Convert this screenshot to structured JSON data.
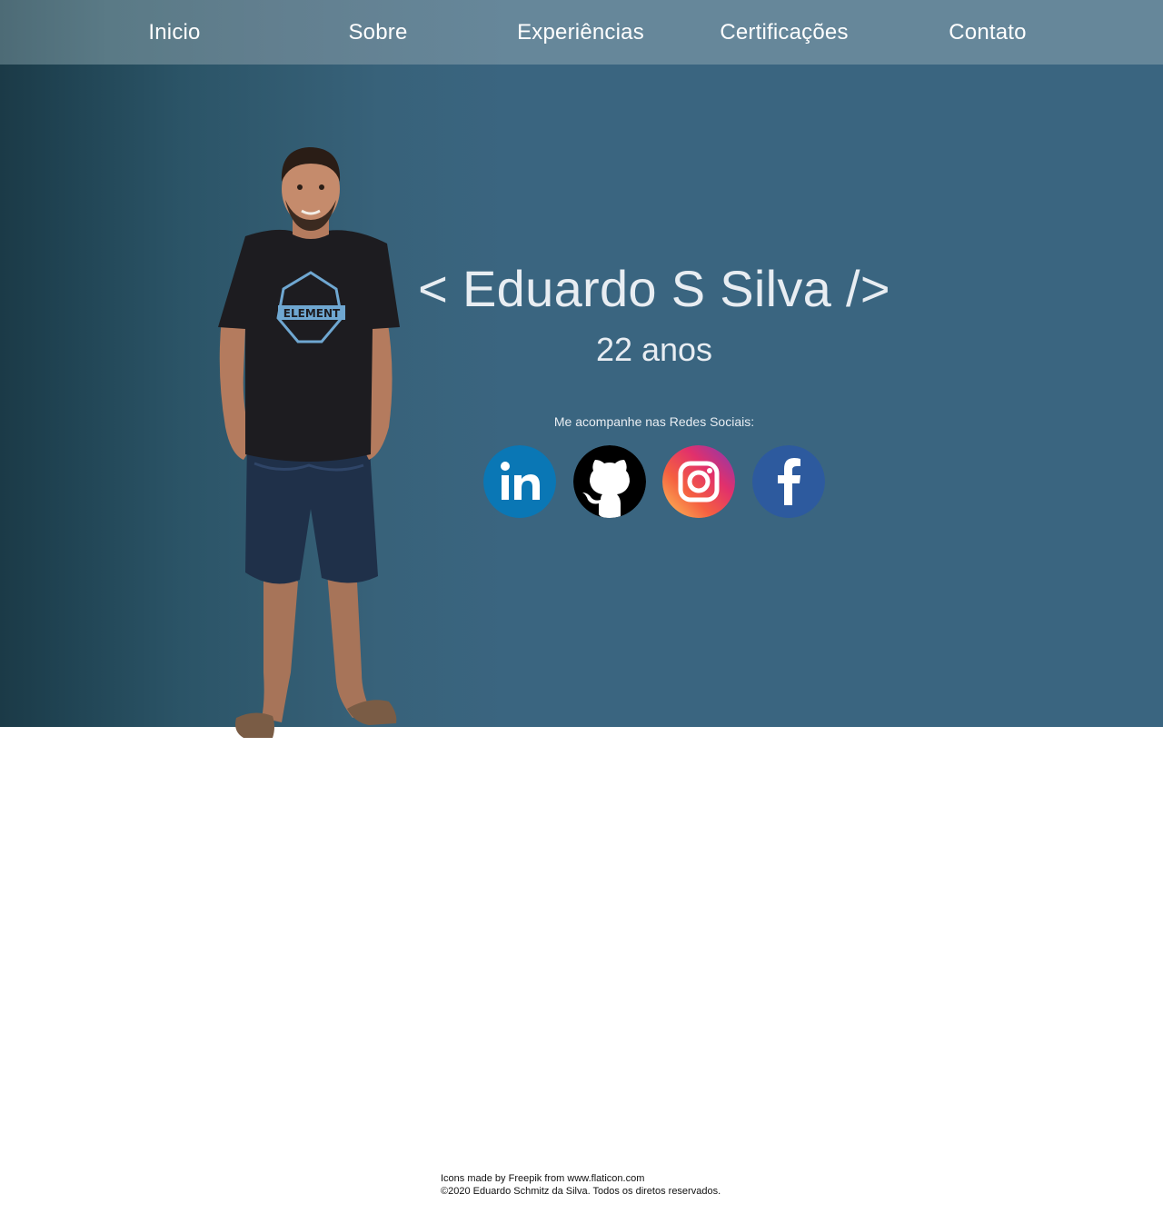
{
  "nav": {
    "items": [
      {
        "label": "Inicio"
      },
      {
        "label": "Sobre"
      },
      {
        "label": "Experiências"
      },
      {
        "label": "Certificações"
      },
      {
        "label": "Contato"
      }
    ]
  },
  "hero": {
    "name": "< Eduardo S Silva />",
    "age": "22 anos",
    "social_prompt": "Me acompanhe nas Redes Sociais:",
    "shirt_logo_text": "ELEMENT",
    "social_links": [
      {
        "icon": "linkedin-icon",
        "color": "#0a77b5"
      },
      {
        "icon": "github-icon",
        "color": "#000000"
      },
      {
        "icon": "instagram-icon",
        "color": "#e1306c"
      },
      {
        "icon": "facebook-icon",
        "color": "#2d5a9e"
      }
    ]
  },
  "footer": {
    "credit": "Icons made by Freepik from www.flaticon.com",
    "copyright": "©2020 Eduardo Schmitz da Silva. Todos os diretos reservados."
  },
  "colors": {
    "hero_background": "#3a6580",
    "navbar_background": "#66879a",
    "text_light": "#e8edf2"
  }
}
